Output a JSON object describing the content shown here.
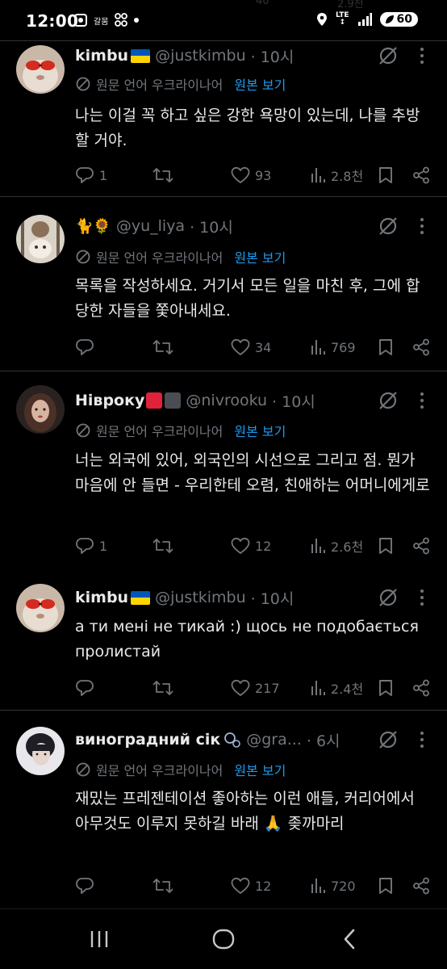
{
  "status_bar": {
    "time": "12:00",
    "small_label": "갈뭄",
    "network": "LTE",
    "battery": "60"
  },
  "top_ghost": {
    "views": "2.9천",
    "likes": "40"
  },
  "translate_label": "원문 언어 우크라이나어",
  "show_original": "원본 보기",
  "tweets": [
    {
      "name": "kimbu",
      "handle": "@justkimbu",
      "time": "· 10시",
      "body": "나는 이걸 꼭 하고 싶은 강한 욕망이 있는데, 나를 추방할 거야.",
      "replies": "1",
      "likes": "93",
      "views": "2.8천"
    },
    {
      "name": "",
      "handle": "@yu_liya",
      "time": "· 10시",
      "body": "목록을 작성하세요. 거기서 모든 일을 마친 후, 그에 합당한 자들을 쫓아내세요.",
      "replies": "",
      "likes": "34",
      "views": "769"
    },
    {
      "name": "Нівроку",
      "handle": "@nivrooku",
      "time": "· 10시",
      "body": "너는 외국에 있어, 외국인의 시선으로 그리고 점. 뭔가 마음에 안 들면 - 우리한테 오렴, 친애하는 어머니에게로",
      "replies": "1",
      "likes": "12",
      "views": "2.6천"
    },
    {
      "name": "kimbu",
      "handle": "@justkimbu",
      "time": "· 10시",
      "body": "а ти мені не тикай :) щось не подобається пролистай",
      "replies": "",
      "likes": "217",
      "views": "2.4천"
    },
    {
      "name": "виноградний сік",
      "handle": "@gra...",
      "time": "· 6시",
      "body": "재밌는 프레젠테이션 좋아하는 이런 애들, 커리어에서 아무것도 이루지 못하길 바래 🙏 좆까마리",
      "replies": "",
      "likes": "12",
      "views": "720"
    }
  ],
  "icons": {
    "reply": "reply-icon",
    "retweet": "retweet-icon",
    "like": "heart-icon",
    "views": "views-icon",
    "bookmark": "bookmark-icon",
    "share": "share-icon",
    "grok": "grok-icon",
    "more": "more-icon",
    "translate": "translate-icon"
  },
  "colors": {
    "background": "#000000",
    "text": "#e7e9ea",
    "muted": "#71767b",
    "link": "#1d9bf0",
    "divider": "#2f3336"
  }
}
